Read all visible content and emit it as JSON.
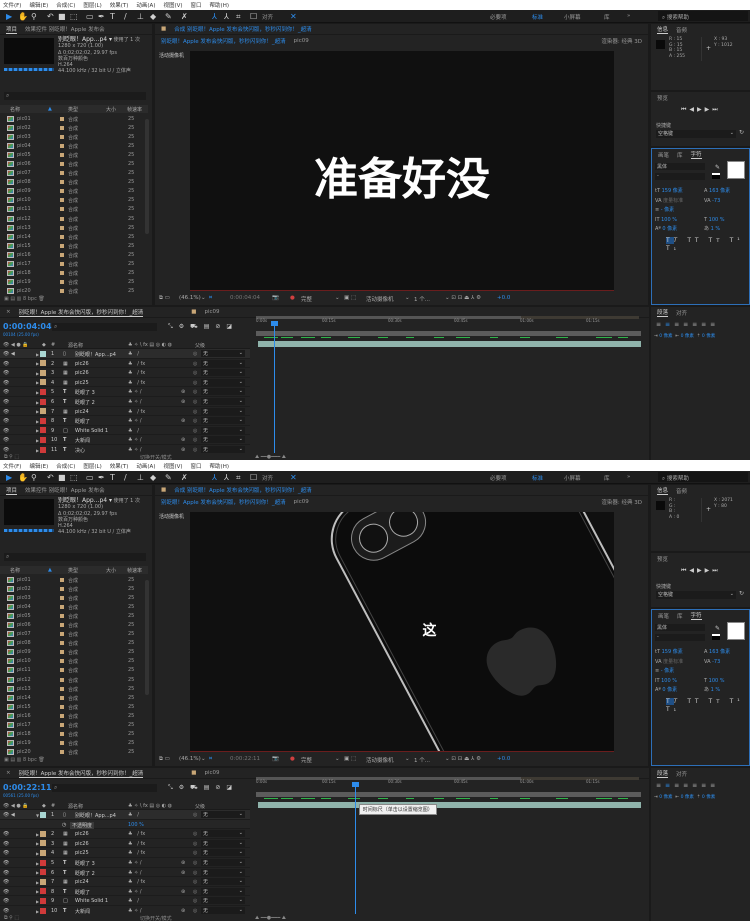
{
  "menu": [
    "文件(F)",
    "编辑(E)",
    "合成(C)",
    "图层(L)",
    "效果(T)",
    "动画(A)",
    "视图(V)",
    "窗口",
    "帮助(H)"
  ],
  "toolbar": {
    "align_label": "对齐"
  },
  "workspaces": [
    "必要项",
    "标准",
    "小屏幕",
    "库"
  ],
  "help_search_placeholder": "搜索帮助",
  "colors": {
    "accent": "#2d8ceb",
    "panel": "#232323",
    "layer_bar": "#8fb3ab",
    "label_red": "#d03a3a",
    "label_tan": "#c9a777",
    "label_teal": "#a9d6d2"
  },
  "screens": [
    {
      "project": {
        "tab": "项目",
        "tab2": "效果控件 别眨眼！Apple 发布会",
        "file_name": "别眨眼！App...p4 ▾",
        "usage": "使用了 1 次",
        "info": [
          "1280 x 720 (1.00)",
          "Δ 0;02;02;02, 29.97 fps",
          "数百万种颜色",
          "H.264",
          "44.100 kHz / 32 bit U / 立体声"
        ],
        "search_placeholder": "⌕",
        "columns": [
          "名称",
          "类型",
          "大小",
          "帧速率"
        ],
        "items": [
          {
            "name": "pic01",
            "type": "合成",
            "fps": "25"
          },
          {
            "name": "pic02",
            "type": "合成",
            "fps": "25"
          },
          {
            "name": "pic03",
            "type": "合成",
            "fps": "25"
          },
          {
            "name": "pic04",
            "type": "合成",
            "fps": "25"
          },
          {
            "name": "pic05",
            "type": "合成",
            "fps": "25"
          },
          {
            "name": "pic06",
            "type": "合成",
            "fps": "25"
          },
          {
            "name": "pic07",
            "type": "合成",
            "fps": "25"
          },
          {
            "name": "pic08",
            "type": "合成",
            "fps": "25"
          },
          {
            "name": "pic09",
            "type": "合成",
            "fps": "25"
          },
          {
            "name": "pic10",
            "type": "合成",
            "fps": "25"
          },
          {
            "name": "pic11",
            "type": "合成",
            "fps": "25"
          },
          {
            "name": "pic12",
            "type": "合成",
            "fps": "25"
          },
          {
            "name": "pic13",
            "type": "合成",
            "fps": "25"
          },
          {
            "name": "pic14",
            "type": "合成",
            "fps": "25"
          },
          {
            "name": "pic15",
            "type": "合成",
            "fps": "25"
          },
          {
            "name": "pic16",
            "type": "合成",
            "fps": "25"
          },
          {
            "name": "pic17",
            "type": "合成",
            "fps": "25"
          },
          {
            "name": "pic18",
            "type": "合成",
            "fps": "25"
          },
          {
            "name": "pic19",
            "type": "合成",
            "fps": "25"
          },
          {
            "name": "pic20",
            "type": "合成",
            "fps": "25"
          }
        ],
        "bpc": "8 bpc"
      },
      "viewer": {
        "tab": "合成 别眨眼！Apple 发布会快闪版，秒秒闪到你！_超清",
        "sub1": "别眨眼！Apple 发布会快闪版，秒秒闪到你！_超清",
        "sub2": "pic09",
        "renderer": "渲染器: 经典 3D",
        "camera_label": "活动摄像机",
        "canvas_text": "准备好没",
        "show_phone": false,
        "zoom": "(46.1%)",
        "time": "0:00:04:04",
        "quality": "完整",
        "camera": "活动摄像机",
        "views": "1 个...",
        "exposure": "+0.0"
      },
      "right": {
        "info_tab": "信息",
        "audio_tab": "音频",
        "rgba": [
          "R : 15",
          "G : 15",
          "B : 15",
          "A : 255"
        ],
        "xy": [
          "X : 93",
          "Y : 1012"
        ],
        "preview_tab": "预览",
        "shortcut_label": "快捷键",
        "shortcut_value": "空格键",
        "char_tabs": [
          "画笔",
          "库",
          "字符"
        ],
        "font": "黑体",
        "style": "-",
        "size": "159 像素",
        "leading": "163 像素",
        "kerning": "度量标准",
        "tracking": "-73",
        "stroke": "- 像素",
        "vscale": "100 %",
        "hscale": "100 %",
        "baseline": "0 像素",
        "tsume": "1 %",
        "para_tabs": [
          "段落",
          "对齐"
        ],
        "indent": "0 像素"
      },
      "timeline": {
        "tab": "别眨眼！Apple 发布会快闪版，秒秒闪到你！_超清",
        "tab2": "pic09",
        "time": "0:00:04:04",
        "frames": "00104 (25.00 fps)",
        "playhead_seconds": 4.16,
        "col_name": "源名称",
        "col_parent": "父级",
        "ruler": [
          "0:00s",
          "00:15s",
          "00:30s",
          "00:45s",
          "01:00s",
          "01:15s"
        ],
        "layers": [
          {
            "num": "1",
            "name": "别眨眼！App...p4",
            "kind": "video",
            "label": "#a9d6d2",
            "fx": false,
            "parent": "无"
          },
          {
            "num": "2",
            "name": "pic26",
            "kind": "comp",
            "label": "#c9a777",
            "fx": true,
            "parent": "无"
          },
          {
            "num": "3",
            "name": "pic26",
            "kind": "comp",
            "label": "#c9a777",
            "fx": true,
            "parent": "无"
          },
          {
            "num": "4",
            "name": "pic25",
            "kind": "comp",
            "label": "#c9a777",
            "fx": true,
            "parent": "无"
          },
          {
            "num": "5",
            "name": "眨眼了 3",
            "kind": "text",
            "label": "#d03a3a",
            "fx": false,
            "parent": "无"
          },
          {
            "num": "6",
            "name": "眨眼了 2",
            "kind": "text",
            "label": "#d03a3a",
            "fx": false,
            "parent": "无"
          },
          {
            "num": "7",
            "name": "pic24",
            "kind": "comp",
            "label": "#c9a777",
            "fx": true,
            "parent": "无"
          },
          {
            "num": "8",
            "name": "眨眼了",
            "kind": "text",
            "label": "#d03a3a",
            "fx": false,
            "parent": "无"
          },
          {
            "num": "9",
            "name": "White Solid 1",
            "kind": "solid",
            "label": "#d03a3a",
            "fx": false,
            "parent": "无"
          },
          {
            "num": "10",
            "name": "大新闻",
            "kind": "text",
            "label": "#d03a3a",
            "fx": false,
            "parent": "无"
          },
          {
            "num": "11",
            "name": "决心",
            "kind": "text",
            "label": "#d03a3a",
            "fx": false,
            "parent": "无"
          }
        ],
        "expanded": null,
        "tooltip": null,
        "toggle_label": "切换开关/模式"
      }
    },
    {
      "project": {
        "tab": "项目",
        "tab2": "效果控件 别眨眼！Apple 发布会",
        "file_name": "别眨眼！App...p4 ▾",
        "usage": "使用了 1 次",
        "info": [
          "1280 x 720 (1.00)",
          "Δ 0;02;02;02, 29.97 fps",
          "数百万种颜色",
          "H.264",
          "44.100 kHz / 32 bit U / 立体声"
        ],
        "search_placeholder": "⌕",
        "columns": [
          "名称",
          "类型",
          "大小",
          "帧速率"
        ],
        "items": [
          {
            "name": "pic01",
            "type": "合成",
            "fps": "25"
          },
          {
            "name": "pic02",
            "type": "合成",
            "fps": "25"
          },
          {
            "name": "pic03",
            "type": "合成",
            "fps": "25"
          },
          {
            "name": "pic04",
            "type": "合成",
            "fps": "25"
          },
          {
            "name": "pic05",
            "type": "合成",
            "fps": "25"
          },
          {
            "name": "pic06",
            "type": "合成",
            "fps": "25"
          },
          {
            "name": "pic07",
            "type": "合成",
            "fps": "25"
          },
          {
            "name": "pic08",
            "type": "合成",
            "fps": "25"
          },
          {
            "name": "pic09",
            "type": "合成",
            "fps": "25"
          },
          {
            "name": "pic10",
            "type": "合成",
            "fps": "25"
          },
          {
            "name": "pic11",
            "type": "合成",
            "fps": "25"
          },
          {
            "name": "pic12",
            "type": "合成",
            "fps": "25"
          },
          {
            "name": "pic13",
            "type": "合成",
            "fps": "25"
          },
          {
            "name": "pic14",
            "type": "合成",
            "fps": "25"
          },
          {
            "name": "pic15",
            "type": "合成",
            "fps": "25"
          },
          {
            "name": "pic16",
            "type": "合成",
            "fps": "25"
          },
          {
            "name": "pic17",
            "type": "合成",
            "fps": "25"
          },
          {
            "name": "pic18",
            "type": "合成",
            "fps": "25"
          },
          {
            "name": "pic19",
            "type": "合成",
            "fps": "25"
          },
          {
            "name": "pic20",
            "type": "合成",
            "fps": "25"
          }
        ],
        "bpc": "8 bpc"
      },
      "viewer": {
        "tab": "合成 别眨眼！Apple 发布会快闪版，秒秒闪到你！_超清",
        "sub1": "别眨眼！Apple 发布会快闪版，秒秒闪到你！_超清",
        "sub2": "pic09",
        "renderer": "渲染器: 经典 3D",
        "camera_label": "活动摄像机",
        "canvas_text": "这",
        "show_phone": true,
        "zoom": "(46.1%)",
        "time": "0:00:22:11",
        "quality": "完整",
        "camera": "活动摄像机",
        "views": "1 个...",
        "exposure": "+0.0"
      },
      "right": {
        "info_tab": "信息",
        "audio_tab": "音频",
        "rgba": [
          "R :",
          "G :",
          "B :",
          "A : 0"
        ],
        "xy": [
          "X : 2071",
          "Y : 80"
        ],
        "preview_tab": "预览",
        "shortcut_label": "快捷键",
        "shortcut_value": "空格键",
        "char_tabs": [
          "画笔",
          "库",
          "字符"
        ],
        "font": "黑体",
        "style": "-",
        "size": "159 像素",
        "leading": "163 像素",
        "kerning": "度量标准",
        "tracking": "-73",
        "stroke": "- 像素",
        "vscale": "100 %",
        "hscale": "100 %",
        "baseline": "0 像素",
        "tsume": "1 %",
        "para_tabs": [
          "段落",
          "对齐"
        ],
        "indent": "0 像素"
      },
      "timeline": {
        "tab": "别眨眼！Apple 发布会快闪版，秒秒闪到你！_超清",
        "tab2": "pic09",
        "time": "0:00:22:11",
        "frames": "00561 (25.00 fps)",
        "playhead_seconds": 22.44,
        "col_name": "源名称",
        "col_parent": "父级",
        "ruler": [
          "0:00s",
          "00:15s",
          "00:30s",
          "00:45s",
          "01:00s",
          "01:15s"
        ],
        "layers": [
          {
            "num": "1",
            "name": "别眨眼！App...p4",
            "kind": "video",
            "label": "#a9d6d2",
            "fx": false,
            "parent": "无"
          },
          {
            "num": "2",
            "name": "pic26",
            "kind": "comp",
            "label": "#c9a777",
            "fx": true,
            "parent": "无"
          },
          {
            "num": "3",
            "name": "pic26",
            "kind": "comp",
            "label": "#c9a777",
            "fx": true,
            "parent": "无"
          },
          {
            "num": "4",
            "name": "pic25",
            "kind": "comp",
            "label": "#c9a777",
            "fx": true,
            "parent": "无"
          },
          {
            "num": "5",
            "name": "眨眼了 3",
            "kind": "text",
            "label": "#d03a3a",
            "fx": false,
            "parent": "无"
          },
          {
            "num": "6",
            "name": "眨眼了 2",
            "kind": "text",
            "label": "#d03a3a",
            "fx": false,
            "parent": "无"
          },
          {
            "num": "7",
            "name": "pic24",
            "kind": "comp",
            "label": "#c9a777",
            "fx": true,
            "parent": "无"
          },
          {
            "num": "8",
            "name": "眨眼了",
            "kind": "text",
            "label": "#d03a3a",
            "fx": false,
            "parent": "无"
          },
          {
            "num": "9",
            "name": "White Solid 1",
            "kind": "solid",
            "label": "#d03a3a",
            "fx": false,
            "parent": "无"
          },
          {
            "num": "10",
            "name": "大新闻",
            "kind": "text",
            "label": "#d03a3a",
            "fx": false,
            "parent": "无"
          }
        ],
        "expanded": {
          "prop": "不透明度",
          "value": "100 %"
        },
        "tooltip": "时间标尺（单击以设置缩览图）",
        "toggle_label": "切换开关/模式"
      }
    }
  ]
}
